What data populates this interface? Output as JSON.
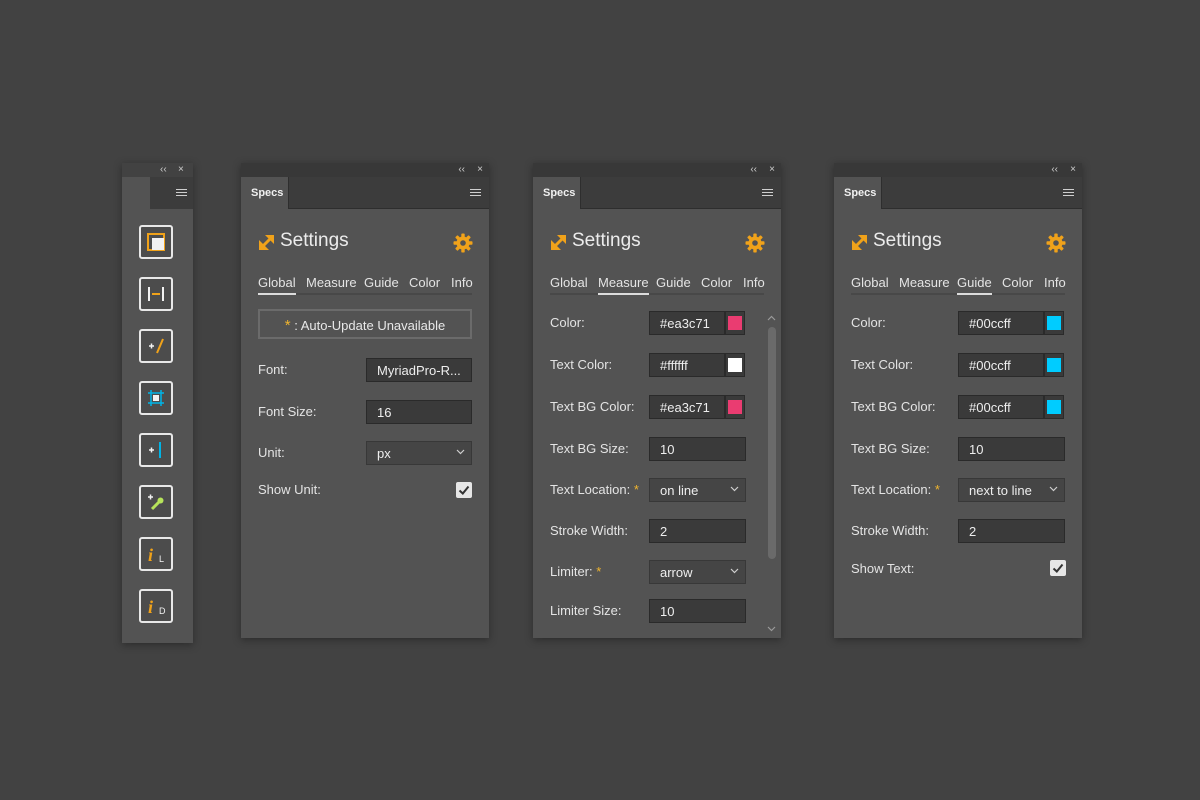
{
  "toolbar_panel": {
    "collapse_glyph": "‹‹",
    "close_glyph": "×",
    "tools": [
      {
        "icon": "artboard-icon"
      },
      {
        "icon": "measure-spacing-icon"
      },
      {
        "icon": "measure-distance-icon"
      },
      {
        "icon": "bounds-icon"
      },
      {
        "icon": "guide-icon"
      },
      {
        "icon": "color-picker-icon"
      },
      {
        "icon": "info-layer-icon",
        "glyph": "i",
        "sub": "L"
      },
      {
        "icon": "info-document-icon",
        "glyph": "i",
        "sub": "D"
      }
    ]
  },
  "panels": [
    {
      "id": "global",
      "tab_label": "Specs",
      "title": "Settings",
      "nav": [
        "Global",
        "Measure",
        "Guide",
        "Color",
        "Info"
      ],
      "active_nav": "Global",
      "notice": {
        "star": "*",
        "text": ": Auto-Update Unavailable"
      },
      "fields": {
        "font": {
          "label": "Font:",
          "value": "MyriadPro-R..."
        },
        "font_size": {
          "label": "Font Size:",
          "value": "16"
        },
        "unit": {
          "label": "Unit:",
          "value": "px"
        },
        "show_unit": {
          "label": "Show Unit:",
          "checked": true
        }
      }
    },
    {
      "id": "measure",
      "tab_label": "Specs",
      "title": "Settings",
      "nav": [
        "Global",
        "Measure",
        "Guide",
        "Color",
        "Info"
      ],
      "active_nav": "Measure",
      "fields": {
        "color": {
          "label": "Color:",
          "value": "#ea3c71",
          "swatch": "#ea3c71"
        },
        "text_color": {
          "label": "Text Color:",
          "value": "#ffffff",
          "swatch": "#ffffff"
        },
        "text_bg_color": {
          "label": "Text BG Color:",
          "value": "#ea3c71",
          "swatch": "#ea3c71"
        },
        "text_bg_size": {
          "label": "Text BG Size:",
          "value": "10"
        },
        "text_location": {
          "label": "Text Location:",
          "required": "*",
          "value": "on line"
        },
        "stroke_width": {
          "label": "Stroke Width:",
          "value": "2"
        },
        "limiter": {
          "label": "Limiter:",
          "required": "*",
          "value": "arrow"
        },
        "limiter_size": {
          "label": "Limiter Size:",
          "value": "10"
        }
      }
    },
    {
      "id": "guide",
      "tab_label": "Specs",
      "title": "Settings",
      "nav": [
        "Global",
        "Measure",
        "Guide",
        "Color",
        "Info"
      ],
      "active_nav": "Guide",
      "fields": {
        "color": {
          "label": "Color:",
          "value": "#00ccff",
          "swatch": "#00ccff"
        },
        "text_color": {
          "label": "Text Color:",
          "value": "#00ccff",
          "swatch": "#00ccff"
        },
        "text_bg_color": {
          "label": "Text BG Color:",
          "value": "#00ccff",
          "swatch": "#00ccff"
        },
        "text_bg_size": {
          "label": "Text BG Size:",
          "value": "10"
        },
        "text_location": {
          "label": "Text Location:",
          "required": "*",
          "value": "next to line"
        },
        "stroke_width": {
          "label": "Stroke Width:",
          "value": "2"
        },
        "show_text": {
          "label": "Show Text:",
          "checked": true
        }
      }
    }
  ],
  "colors": {
    "accent": "#f0a21a",
    "background": "#424242",
    "panel": "#535353"
  }
}
